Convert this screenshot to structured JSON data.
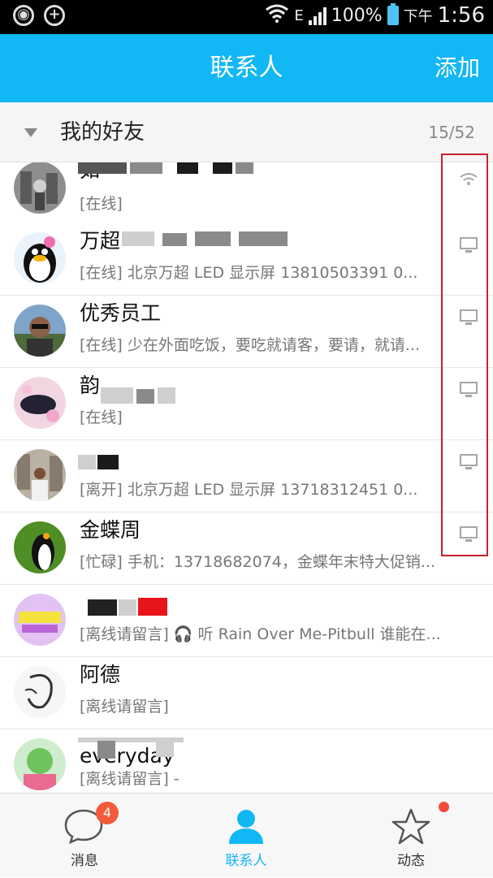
{
  "statusbar": {
    "battery": "100%",
    "network": "E",
    "ampm": "下午",
    "time": "1:56"
  },
  "header": {
    "title": "联系人",
    "add_label": "添加"
  },
  "group": {
    "name": "我的好友",
    "count": "15/52"
  },
  "contacts": [
    {
      "name": "如",
      "status": "[在线]",
      "device": "wifi-icon"
    },
    {
      "name": "万超",
      "status": "[在线] 北京万超 LED 显示屏   13810503391     0...",
      "device": "computer-icon"
    },
    {
      "name": "优秀员工",
      "status": "[在线] 少在外面吃饭，要吃就请客，要请，就请...",
      "device": "computer-icon"
    },
    {
      "name": "韵",
      "status": "[在线]",
      "device": "computer-icon"
    },
    {
      "name": "",
      "status": "[离开] 北京万超 LED 显示屏   13718312451     0...",
      "device": "computer-icon"
    },
    {
      "name": "金蝶周",
      "status": "[忙碌] 手机：13718682074，金蝶年末特大促销...",
      "device": "computer-icon"
    },
    {
      "name": "",
      "status": "[离线请留言] 🎧 听 Rain Over Me-Pitbull  谁能在...",
      "device": ""
    },
    {
      "name": "阿德",
      "status": "[离线请留言]",
      "device": ""
    },
    {
      "name": "everyday",
      "status": "[离线请留言] -",
      "device": ""
    }
  ],
  "tabs": [
    {
      "label": "消息",
      "badge": "4"
    },
    {
      "label": "联系人"
    },
    {
      "label": "动态"
    }
  ],
  "colors": {
    "accent": "#12b7f5",
    "badge": "#f45a3c",
    "highlight_box": "#c8202a"
  }
}
